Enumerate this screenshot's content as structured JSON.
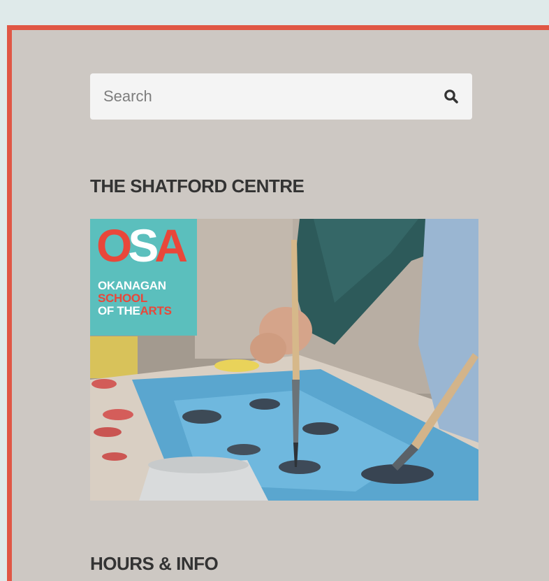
{
  "search": {
    "placeholder": "Search",
    "value": "",
    "icon": "search-icon"
  },
  "sections": {
    "shatford_title": "THE SHATFORD CENTRE",
    "hours_title": "HOURS & INFO"
  },
  "promo": {
    "logo_letters": {
      "o": "O",
      "s": "S",
      "a": "A"
    },
    "logo_line1": "OKANAGAN",
    "logo_line2": "SCHOOL",
    "logo_line3_prefix": "OF THE",
    "logo_line3_suffix": "ARTS",
    "colors": {
      "badge": "#5bbfbd",
      "logo_red": "#e9473a"
    }
  },
  "colors": {
    "accent_border": "#e05745",
    "panel_bg": "#cdc8c3",
    "top_band": "#dfeaea",
    "heading_text": "#333333"
  }
}
